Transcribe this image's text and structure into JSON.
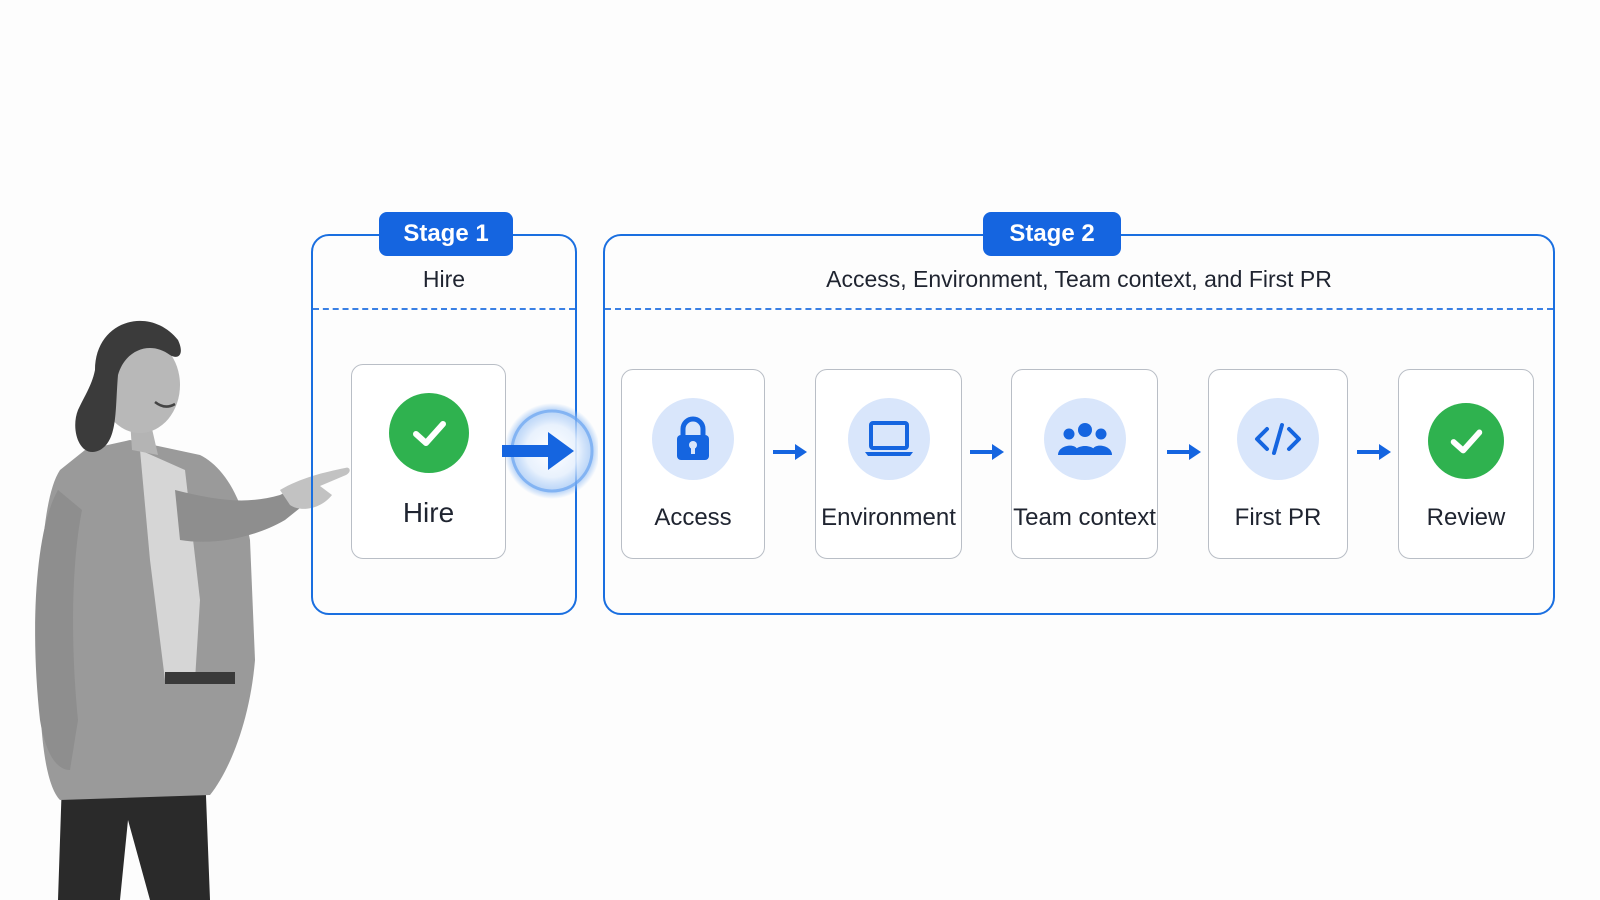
{
  "stage1": {
    "badge": "Stage 1",
    "subtitle": "Hire",
    "steps": [
      {
        "label": "Hire",
        "icon": "check-icon"
      }
    ]
  },
  "stage2": {
    "badge": "Stage 2",
    "subtitle": "Access, Environment, Team context, and First PR",
    "steps": [
      {
        "label": "Access",
        "icon": "lock-icon"
      },
      {
        "label": "Environment",
        "icon": "laptop-icon"
      },
      {
        "label": "Team context",
        "icon": "team-icon"
      },
      {
        "label": "First PR",
        "icon": "code-icon"
      },
      {
        "label": "Review",
        "icon": "check-icon"
      }
    ]
  },
  "colors": {
    "accent": "#1565e0",
    "frame": "#1a6fe0",
    "icon_bg": "#d9e6fb",
    "success": "#2fb24f"
  }
}
